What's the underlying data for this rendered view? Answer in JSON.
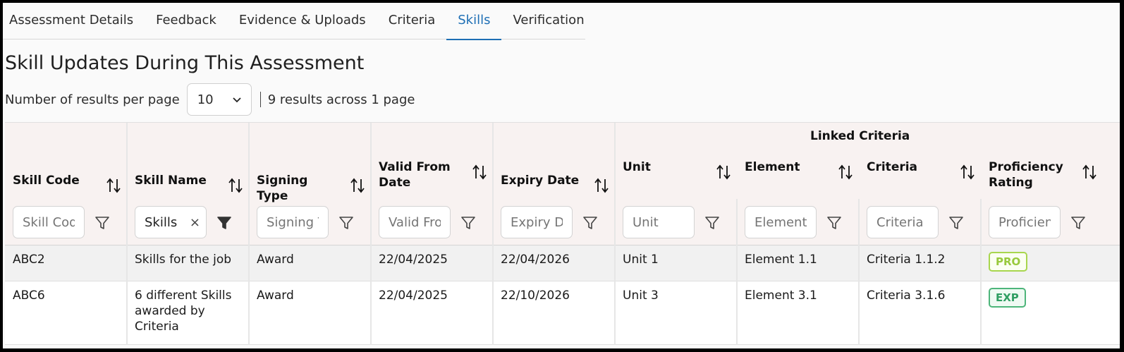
{
  "tabs": [
    "Assessment Details",
    "Feedback",
    "Evidence & Uploads",
    "Criteria",
    "Skills",
    "Verification"
  ],
  "active_tab": "Skills",
  "title": "Skill Updates During This Assessment",
  "pager": {
    "label": "Number of results per page",
    "per_page": "10",
    "summary": "9 results across 1 page"
  },
  "table": {
    "group_header": "Linked Criteria",
    "columns": [
      {
        "key": "skill_code",
        "label": "Skill Code",
        "filter_placeholder": "Skill Code",
        "filter_value": ""
      },
      {
        "key": "skill_name",
        "label": "Skill Name",
        "filter_placeholder": "Skill Name",
        "filter_value": "Skills"
      },
      {
        "key": "signing_type",
        "label": "Signing Type",
        "filter_placeholder": "Signing Type",
        "filter_value": ""
      },
      {
        "key": "valid_from",
        "label": "Valid From Date",
        "filter_placeholder": "Valid From Date",
        "filter_value": ""
      },
      {
        "key": "expiry_date",
        "label": "Expiry Date",
        "filter_placeholder": "Expiry Date",
        "filter_value": ""
      },
      {
        "key": "unit",
        "label": "Unit",
        "filter_placeholder": "Unit",
        "filter_value": ""
      },
      {
        "key": "element",
        "label": "Element",
        "filter_placeholder": "Element",
        "filter_value": ""
      },
      {
        "key": "criteria",
        "label": "Criteria",
        "filter_placeholder": "Criteria",
        "filter_value": ""
      },
      {
        "key": "proficiency",
        "label": "Proficiency Rating",
        "filter_placeholder": "Proficiency",
        "filter_value": ""
      }
    ],
    "rows": [
      {
        "skill_code": "ABC2",
        "skill_name": "Skills for the job",
        "signing_type": "Award",
        "valid_from": "22/04/2025",
        "expiry_date": "22/04/2026",
        "unit": "Unit 1",
        "element": "Element 1.1",
        "criteria": "Criteria 1.1.2",
        "proficiency": "PRO"
      },
      {
        "skill_code": "ABC6",
        "skill_name": "6 different Skills awarded by Criteria",
        "signing_type": "Award",
        "valid_from": "22/04/2025",
        "expiry_date": "22/10/2026",
        "unit": "Unit 3",
        "element": "Element 3.1",
        "criteria": "Criteria 3.1.6",
        "proficiency": "EXP"
      }
    ]
  },
  "colors": {
    "accent": "#1e6fb5",
    "header_bg": "#f8f2f1",
    "pro_badge": "#98c93c",
    "exp_badge": "#2f9e62"
  }
}
